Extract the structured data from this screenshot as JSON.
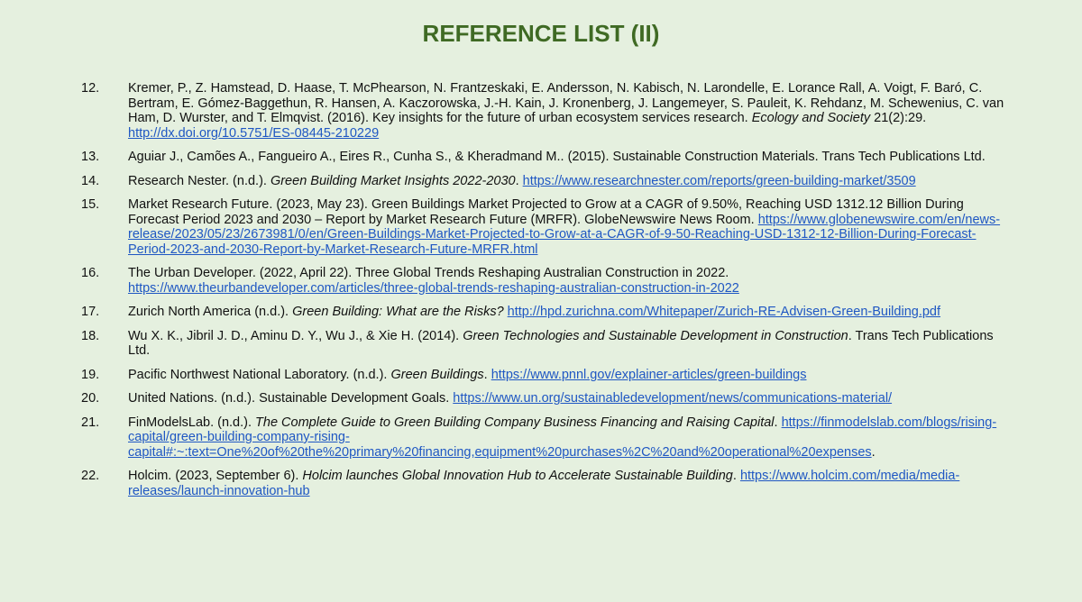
{
  "title": "REFERENCE LIST (II)",
  "refs": [
    {
      "num": "12.",
      "pre": "Kremer, P., Z. Hamstead, D. Haase, T. McPhearson, N. Frantzeskaki, E. Andersson, N. Kabisch, N. Larondelle, E. Lorance Rall, A. Voigt, F. Baró, C. Bertram, E. Gómez-Baggethun, R. Hansen, A. Kaczorowska, J.-H. Kain, J. Kronenberg, J. Langemeyer, S. Pauleit, K. Rehdanz, M. Schewenius, C. van Ham, D. Wurster, and T. Elmqvist. (2016). Key insights for the future of urban ecosystem services research. ",
      "italic": "Ecology and Society",
      "post": " 21(2):29. ",
      "link": "http://dx.doi.org/10.5751/ES-08445-210229",
      "tail": ""
    },
    {
      "num": "13.",
      "pre": "Aguiar J., Camões A., Fangueiro A., Eires R., Cunha S., & Kheradmand M.. (2015). Sustainable Construction Materials. Trans Tech Publications Ltd.",
      "italic": "",
      "post": "",
      "link": "",
      "tail": ""
    },
    {
      "num": "14.",
      "pre": "Research Nester. (n.d.). ",
      "italic": "Green Building Market Insights 2022-2030",
      "post": ". ",
      "link": "https://www.researchnester.com/reports/green-building-market/3509",
      "tail": ""
    },
    {
      "num": "15.",
      "pre": "Market Research Future. (2023, May 23). Green Buildings Market Projected to Grow at a CAGR of 9.50%, Reaching USD 1312.12 Billion During Forecast Period 2023 and 2030 – Report by Market Research Future (MRFR). GlobeNewswire News Room. ",
      "italic": "",
      "post": "",
      "link": "https://www.globenewswire.com/en/news-release/2023/05/23/2673981/0/en/Green-Buildings-Market-Projected-to-Grow-at-a-CAGR-of-9-50-Reaching-USD-1312-12-Billion-During-Forecast-Period-2023-and-2030-Report-by-Market-Research-Future-MRFR.html",
      "tail": ""
    },
    {
      "num": "16.",
      "pre": "The Urban Developer. (2022, April 22). Three Global Trends Reshaping Australian Construction in 2022. ",
      "italic": "",
      "post": "",
      "link": "https://www.theurbandeveloper.com/articles/three-global-trends-reshaping-australian-construction-in-2022",
      "tail": ""
    },
    {
      "num": "17.",
      "pre": "Zurich North America (n.d.). ",
      "italic": "Green Building: What are the Risks?",
      "post": " ",
      "link": "http://hpd.zurichna.com/Whitepaper/Zurich-RE-Advisen-Green-Building.pdf",
      "tail": ""
    },
    {
      "num": "18.",
      "pre": "Wu X. K., Jibril J. D., Aminu D. Y., Wu J., & Xie H. (2014). ",
      "italic": "Green Technologies and Sustainable Development in Construction",
      "post": ". Trans Tech Publications Ltd.",
      "link": "",
      "tail": ""
    },
    {
      "num": "19.",
      "pre": "Pacific Northwest National Laboratory. (n.d.). ",
      "italic": "Green Buildings",
      "post": ". ",
      "link": "https://www.pnnl.gov/explainer-articles/green-buildings",
      "tail": ""
    },
    {
      "num": "20.",
      "pre": "United Nations. (n.d.). Sustainable Development Goals. ",
      "italic": "",
      "post": "",
      "link": "https://www.un.org/sustainabledevelopment/news/communications-material/",
      "tail": ""
    },
    {
      "num": "21.",
      "pre": "FinModelsLab. (n.d.). ",
      "italic": "The Complete Guide to Green Building Company Business Financing and Raising Capital",
      "post": ". ",
      "link": "https://finmodelslab.com/blogs/rising-capital/green-building-company-rising-capital#:~:text=One%20of%20the%20primary%20financing,equipment%20purchases%2C%20and%20operational%20expenses",
      "tail": "."
    },
    {
      "num": "22.",
      "pre": "Holcim. (2023, September 6). ",
      "italic": "Holcim launches Global Innovation Hub to Accelerate Sustainable Building",
      "post": ". ",
      "link": "https://www.holcim.com/media/media-releases/launch-innovation-hub",
      "tail": ""
    }
  ]
}
